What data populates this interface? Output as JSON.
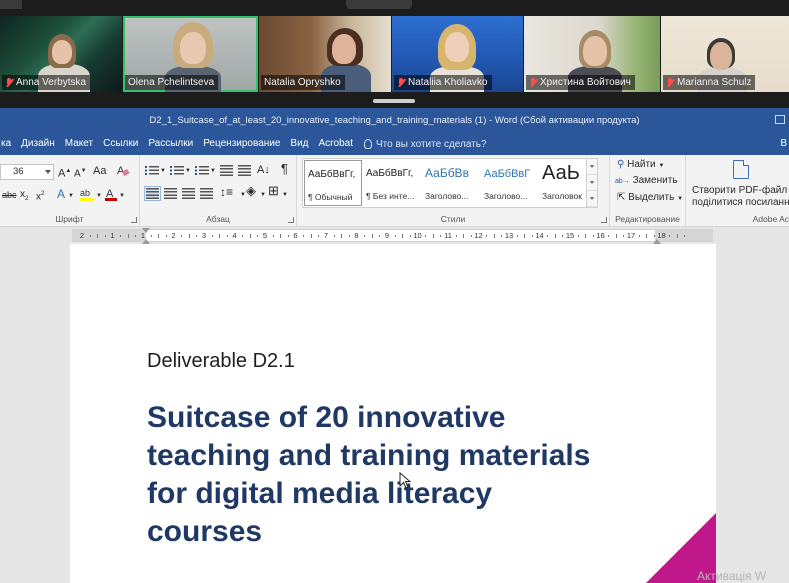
{
  "participants": [
    {
      "name": "Anna Verbytska",
      "muted": true,
      "active": false
    },
    {
      "name": "Olena Pchelintseva",
      "muted": false,
      "active": true
    },
    {
      "name": "Natalia Opryshko",
      "muted": false,
      "active": false
    },
    {
      "name": "Nataliia Kholiavko",
      "muted": true,
      "active": false
    },
    {
      "name": "Христина Войтович",
      "muted": true,
      "active": false
    },
    {
      "name": "Marianna Schulz",
      "muted": true,
      "active": false
    }
  ],
  "word": {
    "title": "D2_1_Suitcase_of_at_least_20_innovative_teaching_and_training_materials (1) - Word (Сбой активации продукта)",
    "tabs": [
      "ка",
      "Дизайн",
      "Макет",
      "Ссылки",
      "Рассылки",
      "Рецензирование",
      "Вид",
      "Acrobat"
    ],
    "tell_me": "Что вы хотите сделать?",
    "tab_right": "В",
    "ribbon": {
      "font_size": "36",
      "font_group_label": "Шрифт",
      "paragraph_group_label": "Абзац",
      "styles_group_label": "Стили",
      "editing_group_label": "Редактирование",
      "adobe_group_label": "Adobe Ac",
      "styles": [
        {
          "preview": "АаБбВвГг,",
          "name": "¶ Обычный",
          "selected": true
        },
        {
          "preview": "АаБбВвГг,",
          "name": "¶ Без инте...",
          "selected": false
        },
        {
          "preview": "АаБбВв",
          "name": "Заголово...",
          "selected": false
        },
        {
          "preview": "АаБбВвГ",
          "name": "Заголово...",
          "selected": false
        },
        {
          "preview": "АаЬ",
          "name": "Заголовок",
          "selected": false
        }
      ],
      "find_label": "Найти",
      "replace_label": "Заменить",
      "select_label": "Выделить",
      "pdf_line1": "Створити PDF-файл і",
      "pdf_line2": "поділитися посиланням",
      "font_color_swatch": "#c00000",
      "highlight_swatch": "#ffff00"
    },
    "ruler_numbers": [
      "2",
      "1",
      "1",
      "2",
      "3",
      "4",
      "5",
      "6",
      "7",
      "8",
      "9",
      "10",
      "11",
      "12",
      "13",
      "14",
      "15",
      "16",
      "17",
      "18"
    ]
  },
  "document": {
    "deliverable": "Deliverable D2.1",
    "title_lines": [
      "Suitcase of 20 innovative",
      "teaching and training materials",
      "for digital media literacy",
      "courses"
    ],
    "title_color": "#1f3864",
    "accent_color": "#c0188a"
  },
  "watermark": "Активація W"
}
